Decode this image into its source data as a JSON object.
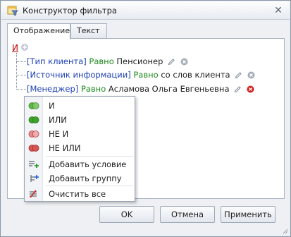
{
  "window": {
    "title": "Конструктор фильтра",
    "close_glyph": "✕"
  },
  "tabs": [
    {
      "label": "Отображение",
      "active": true
    },
    {
      "label": "Текст",
      "active": false
    }
  ],
  "filter": {
    "root_group_label": "И",
    "conditions": [
      {
        "field": "[Тип клиента]",
        "operator": "Равно",
        "value": "Пенсионер",
        "remove_active": false
      },
      {
        "field": "[Источник информации]",
        "operator": "Равно",
        "value": "со слов клиента",
        "remove_active": false
      },
      {
        "field": "[Менеджер]",
        "operator": "Равно",
        "value": "Асламова Ольга Евгеньевна",
        "remove_active": true
      }
    ]
  },
  "context_menu": {
    "items": [
      {
        "label": "И",
        "icon": "and-group-icon"
      },
      {
        "label": "ИЛИ",
        "icon": "or-group-icon"
      },
      {
        "label": "НЕ И",
        "icon": "not-and-group-icon"
      },
      {
        "label": "НЕ ИЛИ",
        "icon": "not-or-group-icon"
      },
      {
        "label": "Добавить условие",
        "icon": "add-condition-icon"
      },
      {
        "label": "Добавить группу",
        "icon": "add-group-icon"
      },
      {
        "label": "Очистить все",
        "icon": "clear-all-icon"
      }
    ]
  },
  "buttons": {
    "ok": "OK",
    "cancel": "Отмена",
    "apply": "Применить"
  },
  "colors": {
    "field": "#1c3fb8",
    "operator": "#1d8a1d",
    "root_group": "#c00000",
    "remove_active": "#d62020",
    "remove_inactive": "#9aa3ad"
  }
}
